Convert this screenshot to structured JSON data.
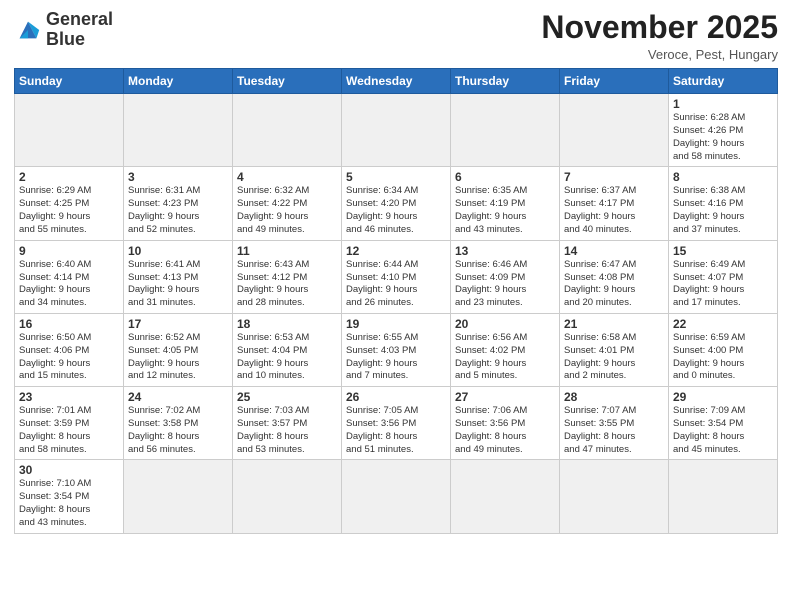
{
  "header": {
    "logo_text_regular": "General",
    "logo_text_bold": "Blue",
    "month_title": "November 2025",
    "location": "Veroce, Pest, Hungary"
  },
  "weekdays": [
    "Sunday",
    "Monday",
    "Tuesday",
    "Wednesday",
    "Thursday",
    "Friday",
    "Saturday"
  ],
  "weeks": [
    [
      {
        "day": "",
        "info": ""
      },
      {
        "day": "",
        "info": ""
      },
      {
        "day": "",
        "info": ""
      },
      {
        "day": "",
        "info": ""
      },
      {
        "day": "",
        "info": ""
      },
      {
        "day": "",
        "info": ""
      },
      {
        "day": "1",
        "info": "Sunrise: 6:28 AM\nSunset: 4:26 PM\nDaylight: 9 hours\nand 58 minutes."
      }
    ],
    [
      {
        "day": "2",
        "info": "Sunrise: 6:29 AM\nSunset: 4:25 PM\nDaylight: 9 hours\nand 55 minutes."
      },
      {
        "day": "3",
        "info": "Sunrise: 6:31 AM\nSunset: 4:23 PM\nDaylight: 9 hours\nand 52 minutes."
      },
      {
        "day": "4",
        "info": "Sunrise: 6:32 AM\nSunset: 4:22 PM\nDaylight: 9 hours\nand 49 minutes."
      },
      {
        "day": "5",
        "info": "Sunrise: 6:34 AM\nSunset: 4:20 PM\nDaylight: 9 hours\nand 46 minutes."
      },
      {
        "day": "6",
        "info": "Sunrise: 6:35 AM\nSunset: 4:19 PM\nDaylight: 9 hours\nand 43 minutes."
      },
      {
        "day": "7",
        "info": "Sunrise: 6:37 AM\nSunset: 4:17 PM\nDaylight: 9 hours\nand 40 minutes."
      },
      {
        "day": "8",
        "info": "Sunrise: 6:38 AM\nSunset: 4:16 PM\nDaylight: 9 hours\nand 37 minutes."
      }
    ],
    [
      {
        "day": "9",
        "info": "Sunrise: 6:40 AM\nSunset: 4:14 PM\nDaylight: 9 hours\nand 34 minutes."
      },
      {
        "day": "10",
        "info": "Sunrise: 6:41 AM\nSunset: 4:13 PM\nDaylight: 9 hours\nand 31 minutes."
      },
      {
        "day": "11",
        "info": "Sunrise: 6:43 AM\nSunset: 4:12 PM\nDaylight: 9 hours\nand 28 minutes."
      },
      {
        "day": "12",
        "info": "Sunrise: 6:44 AM\nSunset: 4:10 PM\nDaylight: 9 hours\nand 26 minutes."
      },
      {
        "day": "13",
        "info": "Sunrise: 6:46 AM\nSunset: 4:09 PM\nDaylight: 9 hours\nand 23 minutes."
      },
      {
        "day": "14",
        "info": "Sunrise: 6:47 AM\nSunset: 4:08 PM\nDaylight: 9 hours\nand 20 minutes."
      },
      {
        "day": "15",
        "info": "Sunrise: 6:49 AM\nSunset: 4:07 PM\nDaylight: 9 hours\nand 17 minutes."
      }
    ],
    [
      {
        "day": "16",
        "info": "Sunrise: 6:50 AM\nSunset: 4:06 PM\nDaylight: 9 hours\nand 15 minutes."
      },
      {
        "day": "17",
        "info": "Sunrise: 6:52 AM\nSunset: 4:05 PM\nDaylight: 9 hours\nand 12 minutes."
      },
      {
        "day": "18",
        "info": "Sunrise: 6:53 AM\nSunset: 4:04 PM\nDaylight: 9 hours\nand 10 minutes."
      },
      {
        "day": "19",
        "info": "Sunrise: 6:55 AM\nSunset: 4:03 PM\nDaylight: 9 hours\nand 7 minutes."
      },
      {
        "day": "20",
        "info": "Sunrise: 6:56 AM\nSunset: 4:02 PM\nDaylight: 9 hours\nand 5 minutes."
      },
      {
        "day": "21",
        "info": "Sunrise: 6:58 AM\nSunset: 4:01 PM\nDaylight: 9 hours\nand 2 minutes."
      },
      {
        "day": "22",
        "info": "Sunrise: 6:59 AM\nSunset: 4:00 PM\nDaylight: 9 hours\nand 0 minutes."
      }
    ],
    [
      {
        "day": "23",
        "info": "Sunrise: 7:01 AM\nSunset: 3:59 PM\nDaylight: 8 hours\nand 58 minutes."
      },
      {
        "day": "24",
        "info": "Sunrise: 7:02 AM\nSunset: 3:58 PM\nDaylight: 8 hours\nand 56 minutes."
      },
      {
        "day": "25",
        "info": "Sunrise: 7:03 AM\nSunset: 3:57 PM\nDaylight: 8 hours\nand 53 minutes."
      },
      {
        "day": "26",
        "info": "Sunrise: 7:05 AM\nSunset: 3:56 PM\nDaylight: 8 hours\nand 51 minutes."
      },
      {
        "day": "27",
        "info": "Sunrise: 7:06 AM\nSunset: 3:56 PM\nDaylight: 8 hours\nand 49 minutes."
      },
      {
        "day": "28",
        "info": "Sunrise: 7:07 AM\nSunset: 3:55 PM\nDaylight: 8 hours\nand 47 minutes."
      },
      {
        "day": "29",
        "info": "Sunrise: 7:09 AM\nSunset: 3:54 PM\nDaylight: 8 hours\nand 45 minutes."
      }
    ],
    [
      {
        "day": "30",
        "info": "Sunrise: 7:10 AM\nSunset: 3:54 PM\nDaylight: 8 hours\nand 43 minutes."
      },
      {
        "day": "",
        "info": ""
      },
      {
        "day": "",
        "info": ""
      },
      {
        "day": "",
        "info": ""
      },
      {
        "day": "",
        "info": ""
      },
      {
        "day": "",
        "info": ""
      },
      {
        "day": "",
        "info": ""
      }
    ]
  ]
}
